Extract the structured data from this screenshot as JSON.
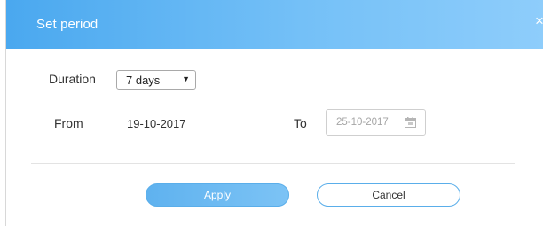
{
  "dialog": {
    "title": "Set period",
    "close_glyph": "×"
  },
  "form": {
    "duration_label": "Duration",
    "duration_value": "7 days",
    "from_label": "From",
    "from_value": "19-10-2017",
    "to_label": "To",
    "to_value": "25-10-2017",
    "to_icon": "calendar-icon"
  },
  "actions": {
    "apply_label": "Apply",
    "cancel_label": "Cancel"
  },
  "colors": {
    "header_start": "#4aa8ef",
    "header_end": "#8ecdfb",
    "accent": "#5aaeea"
  }
}
